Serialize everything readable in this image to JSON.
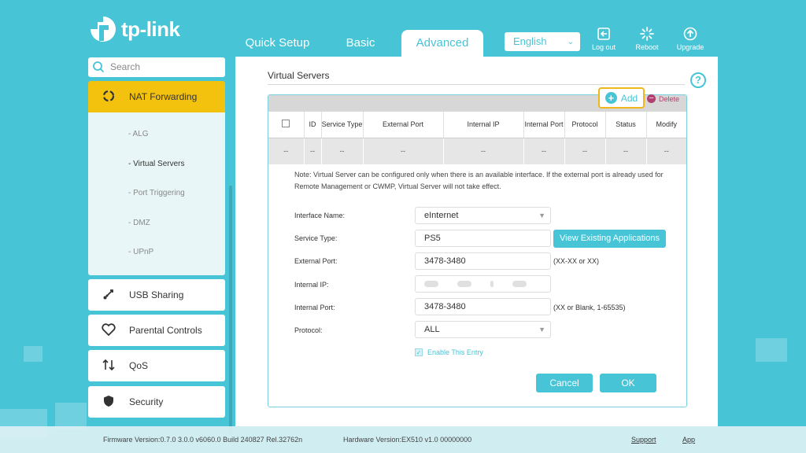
{
  "brand": {
    "name": "tp-link",
    "accent": "#47c4d6",
    "highlight": "#f3c20f"
  },
  "tabs": [
    {
      "label": "Quick Setup"
    },
    {
      "label": "Basic"
    },
    {
      "label": "Advanced",
      "active": true
    }
  ],
  "header": {
    "language": "English",
    "logout": "Log out",
    "reboot": "Reboot",
    "upgrade": "Upgrade"
  },
  "sidebar": {
    "search_placeholder": "Search",
    "active_section": "NAT Forwarding",
    "sub_items": [
      "- ALG",
      "- Virtual Servers",
      "- Port Triggering",
      "- DMZ",
      "- UPnP"
    ],
    "active_sub_item": "- Virtual Servers",
    "sections": [
      "USB Sharing",
      "Parental Controls",
      "QoS",
      "Security"
    ]
  },
  "main": {
    "title": "Virtual Servers",
    "add_label": "Add",
    "delete_label": "Delete",
    "table": {
      "columns": [
        "ID",
        "Service Type",
        "External Port",
        "Internal IP",
        "Internal Port",
        "Protocol",
        "Status",
        "Modify"
      ],
      "row": [
        "--",
        "--",
        "--",
        "--",
        "--",
        "--",
        "--",
        "--",
        "--"
      ]
    },
    "note": "Note: Virtual Server can be configured only when there is an available interface. If the external port is already used for Remote Management or CWMP, Virtual Server will not take effect.",
    "form": {
      "interface_label": "Interface Name:",
      "interface_value": "eInternet",
      "service_label": "Service Type:",
      "service_value": "PS5",
      "view_existing": "View Existing Applications",
      "external_label": "External Port:",
      "external_value": "3478-3480",
      "external_hint": "(XX-XX or XX)",
      "internal_ip_label": "Internal IP:",
      "internal_port_label": "Internal Port:",
      "internal_port_value": "3478-3480",
      "internal_port_hint": "(XX or Blank, 1-65535)",
      "protocol_label": "Protocol:",
      "protocol_value": "ALL",
      "enable_label": "Enable This Entry"
    },
    "cancel": "Cancel",
    "ok": "OK"
  },
  "footer": {
    "firmware": "Firmware Version:0.7.0 3.0.0 v6060.0 Build 240827 Rel.32762n",
    "hardware": "Hardware Version:EX510 v1.0 00000000",
    "support": "Support",
    "app": "App"
  }
}
